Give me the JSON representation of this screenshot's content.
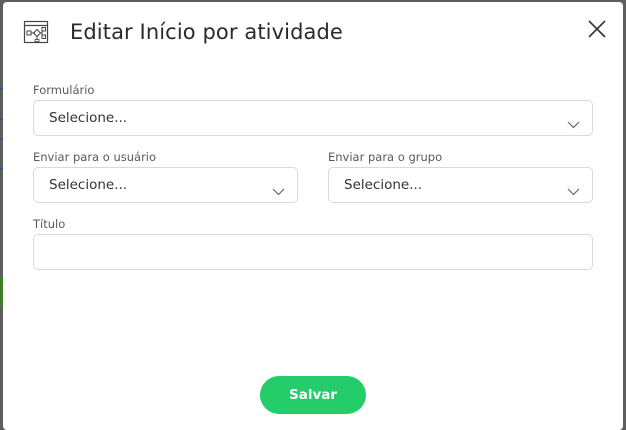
{
  "dialog": {
    "title": "Editar Início por atividade",
    "header_icon": "workflow-diagram-icon",
    "close_icon": "close-icon"
  },
  "form": {
    "formulario": {
      "label": "Formulário",
      "value": "Selecione..."
    },
    "enviar_usuario": {
      "label": "Enviar para o usuário",
      "value": "Selecione..."
    },
    "enviar_grupo": {
      "label": "Enviar para o grupo",
      "value": "Selecione..."
    },
    "titulo": {
      "label": "Título",
      "value": ""
    }
  },
  "actions": {
    "save_label": "Salvar"
  },
  "colors": {
    "accent": "#22cd6a",
    "backdrop": "#5e5e5e",
    "border": "#d9d9d9"
  }
}
